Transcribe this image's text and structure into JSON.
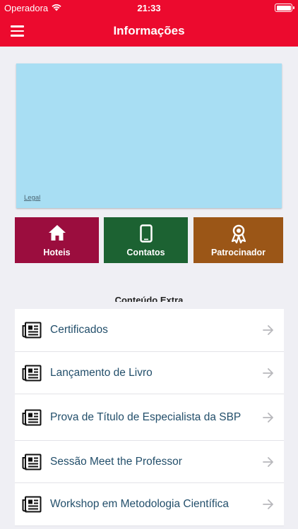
{
  "status_bar": {
    "carrier": "Operadora",
    "time": "21:33"
  },
  "nav": {
    "title": "Informações"
  },
  "map": {
    "legal": "Legal"
  },
  "tiles": [
    {
      "label": "Hoteis",
      "icon": "home-icon",
      "color": "#9b0d3e"
    },
    {
      "label": "Contatos",
      "icon": "phone-icon",
      "color": "#1c6232"
    },
    {
      "label": "Patrocinador",
      "icon": "award-ribbon-icon",
      "color": "#9b5617"
    }
  ],
  "section": {
    "title": "Conteúdo Extra"
  },
  "list": {
    "items": [
      {
        "label": "Certificados"
      },
      {
        "label": "Lançamento de Livro"
      },
      {
        "label": "Prova de Título de Especialista da SBP"
      },
      {
        "label": "Sessão Meet the Professor"
      },
      {
        "label": "Workshop em Metodologia Científica"
      }
    ]
  },
  "colors": {
    "brand": "#ec0a2e",
    "background": "#efeff4",
    "item_text": "#234f6b"
  }
}
